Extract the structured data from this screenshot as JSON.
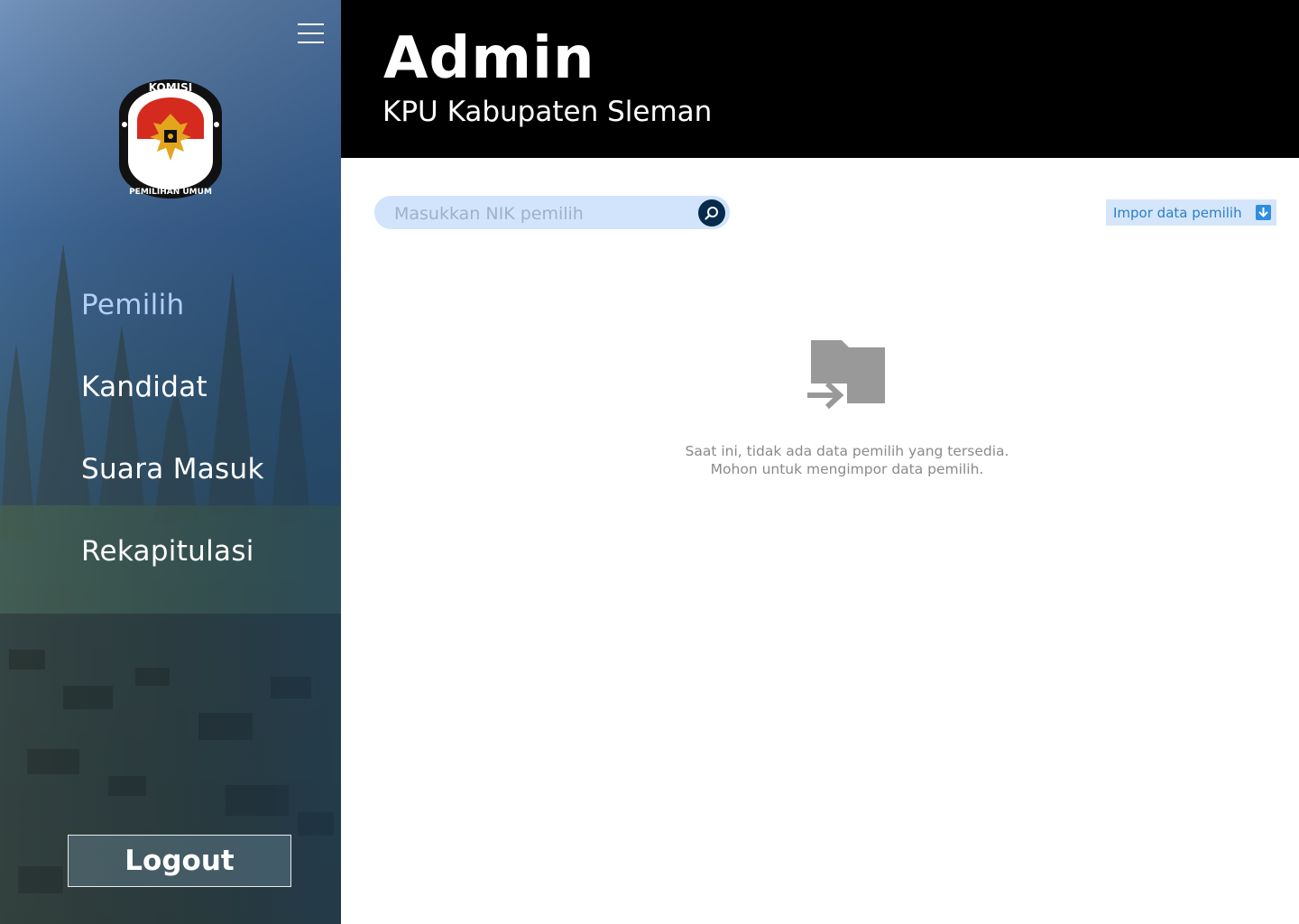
{
  "sidebar": {
    "menu_icon": "hamburger-menu-icon",
    "logo_text_top": "KOMISI",
    "logo_text_bottom": "PEMILIHAN UMUM",
    "items": [
      {
        "label": "Pemilih",
        "active": true
      },
      {
        "label": "Kandidat",
        "active": false
      },
      {
        "label": "Suara Masuk",
        "active": false
      },
      {
        "label": "Rekapitulasi",
        "active": false
      }
    ],
    "logout_label": "Logout"
  },
  "header": {
    "title": "Admin",
    "subtitle": "KPU Kabupaten Sleman"
  },
  "search": {
    "placeholder": "Masukkan NIK pemilih",
    "value": "",
    "icon": "search-icon"
  },
  "import": {
    "label": "Impor data pemilih",
    "icon": "download-icon"
  },
  "empty_state": {
    "icon": "folder-import-icon",
    "line1": "Saat ini, tidak ada data pemilih yang tersedia.",
    "line2": "Mohon untuk mengimpor data pemilih."
  },
  "colors": {
    "header_bg": "#000000",
    "active_nav": "#b3cff7",
    "search_bg": "#d2e4fb",
    "search_button": "#072b4a",
    "import_bg": "#d5e6fa",
    "import_text": "#2a7fc6",
    "empty_text": "#8a8a8a"
  }
}
